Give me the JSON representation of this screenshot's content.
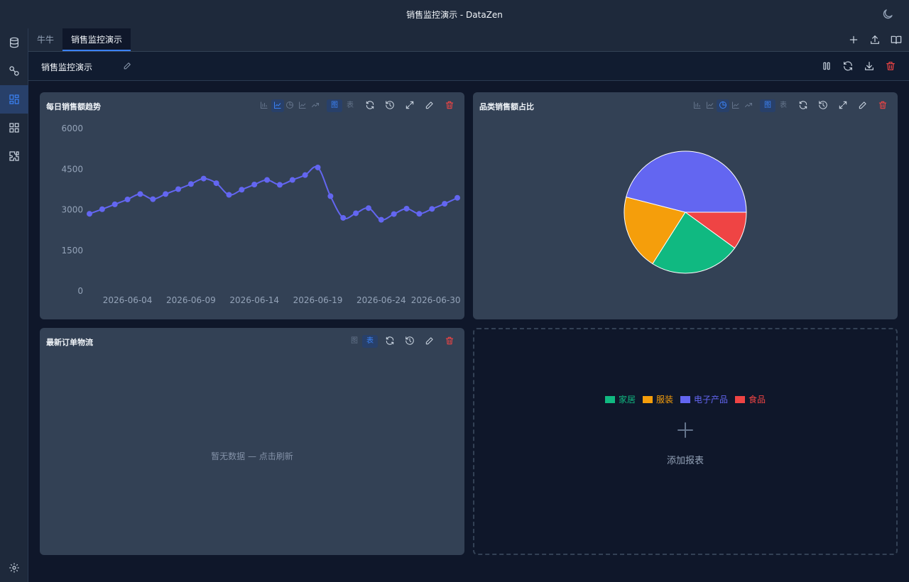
{
  "window": {
    "title": "销售监控演示 - DataZen"
  },
  "tabs": [
    {
      "label": "牛牛"
    },
    {
      "label": "销售监控演示"
    }
  ],
  "dashboard": {
    "title": "销售监控演示"
  },
  "panels": {
    "trend": {
      "title": "每日销售额趋势",
      "toggle_chart": "图",
      "toggle_table": "表"
    },
    "category": {
      "title": "品类销售额占比",
      "toggle_chart": "图",
      "toggle_table": "表"
    },
    "orders": {
      "title": "最新订单物流",
      "toggle_chart": "图",
      "toggle_table": "表",
      "empty_text": "暂无数据 — 点击刷新"
    }
  },
  "add_report": {
    "label": "添加报表"
  },
  "colors": {
    "line": "#6366f1",
    "accent": "#3b82f6",
    "danger": "#ef4444"
  },
  "chart_data": [
    {
      "type": "line",
      "title": "每日销售额趋势",
      "ylim": [
        0,
        6000
      ],
      "yticks": [
        0,
        1500,
        3000,
        4500,
        6000
      ],
      "xtick_labels": [
        "2026-06-04",
        "2026-06-09",
        "2026-06-14",
        "2026-06-19",
        "2026-06-24",
        "2026-06-30"
      ],
      "xtick_index": [
        3,
        8,
        13,
        18,
        23,
        27.3
      ],
      "grid": false,
      "series": [
        {
          "color": "#6366f1",
          "values": [
            2850,
            3020,
            3200,
            3380,
            3580,
            3390,
            3580,
            3760,
            3950,
            4150,
            3980,
            3550,
            3740,
            3930,
            4100,
            3920,
            4100,
            4280,
            4560,
            3500,
            2700,
            2870,
            3060,
            2630,
            2840,
            3040,
            2850,
            3030,
            3220,
            3440
          ]
        }
      ]
    },
    {
      "type": "pie",
      "title": "品类销售额占比",
      "legend_position": "bottom",
      "slices": [
        {
          "label": "家居",
          "value": 24,
          "color": "#10b981"
        },
        {
          "label": "服装",
          "value": 20,
          "color": "#f59e0b"
        },
        {
          "label": "电子产品",
          "value": 46,
          "color": "#6366f1"
        },
        {
          "label": "食品",
          "value": 10,
          "color": "#ef4444"
        }
      ]
    }
  ]
}
